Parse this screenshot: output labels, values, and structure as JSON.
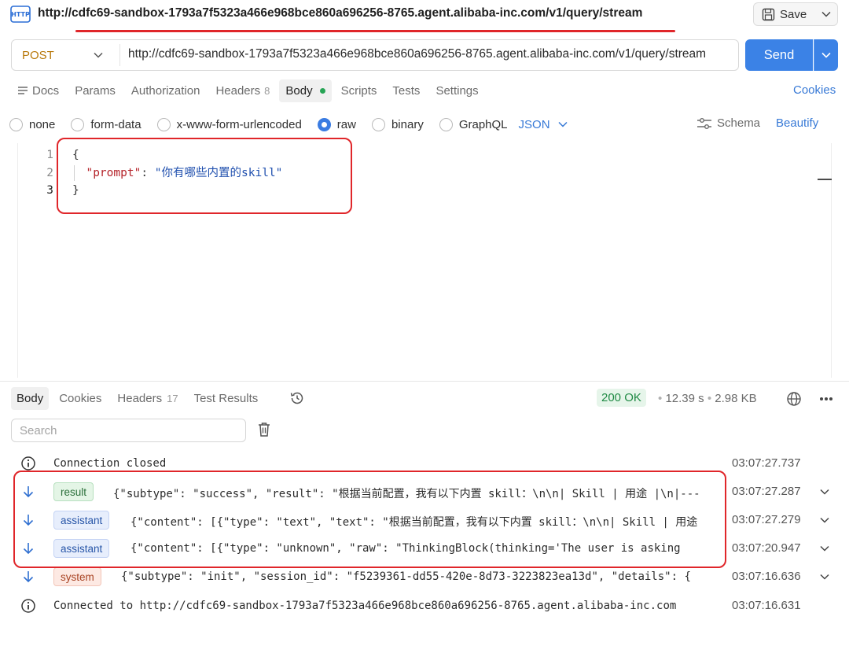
{
  "window": {
    "title_url": "http://cdfc69-sandbox-1793a7f5323a466e968bce860a696256-8765.agent.alibaba-inc.com/v1/query/stream",
    "save_label": "Save"
  },
  "request": {
    "method": "POST",
    "url": "http://cdfc69-sandbox-1793a7f5323a466e968bce860a696256-8765.agent.alibaba-inc.com/v1/query/stream",
    "send_label": "Send"
  },
  "tabs": {
    "docs": "Docs",
    "params": "Params",
    "authorization": "Authorization",
    "headers": "Headers",
    "headers_count": "8",
    "body": "Body",
    "scripts": "Scripts",
    "tests": "Tests",
    "settings": "Settings",
    "cookies": "Cookies"
  },
  "body_types": {
    "none": "none",
    "form_data": "form-data",
    "urlencoded": "x-www-form-urlencoded",
    "raw": "raw",
    "binary": "binary",
    "graphql": "GraphQL",
    "format": "JSON",
    "schema": "Schema",
    "beautify": "Beautify"
  },
  "editor": {
    "line_numbers": [
      "1",
      "2",
      "3"
    ],
    "open_brace": "{",
    "key": "\"prompt\"",
    "colon": ": ",
    "value": "\"你有哪些内置的skill\"",
    "close_brace": "}"
  },
  "response": {
    "tabs": {
      "body": "Body",
      "cookies": "Cookies",
      "headers": "Headers",
      "headers_count": "17",
      "test_results": "Test Results"
    },
    "status": "200 OK",
    "time": "12.39 s",
    "size": "2.98 KB",
    "search_placeholder": "Search",
    "rows": [
      {
        "badge": "",
        "text": "Connection closed",
        "time": "03:07:27.737"
      },
      {
        "badge": "result",
        "text": "{\"subtype\": \"success\", \"result\": \"根据当前配置，我有以下内置 skill：\\n\\n| Skill | 用途 |\\n|---",
        "time": "03:07:27.287"
      },
      {
        "badge": "assistant",
        "text": "{\"content\": [{\"type\": \"text\", \"text\": \"根据当前配置，我有以下内置 skill：\\n\\n| Skill | 用途",
        "time": "03:07:27.279"
      },
      {
        "badge": "assistant",
        "text": "{\"content\": [{\"type\": \"unknown\", \"raw\": \"ThinkingBlock(thinking='The user is asking",
        "time": "03:07:20.947"
      },
      {
        "badge": "system",
        "text": "{\"subtype\": \"init\", \"session_id\": \"f5239361-dd55-420e-8d73-3223823ea13d\", \"details\": {",
        "time": "03:07:16.636"
      },
      {
        "badge": "",
        "text": "Connected to http://cdfc69-sandbox-1793a7f5323a466e968bce860a696256-8765.agent.alibaba-inc.com",
        "time": "03:07:16.631"
      }
    ]
  },
  "colors": {
    "accent": "#3b82e6",
    "highlight": "#e0262a",
    "method": "#b8780a",
    "status_ok": "#1f8a44"
  }
}
